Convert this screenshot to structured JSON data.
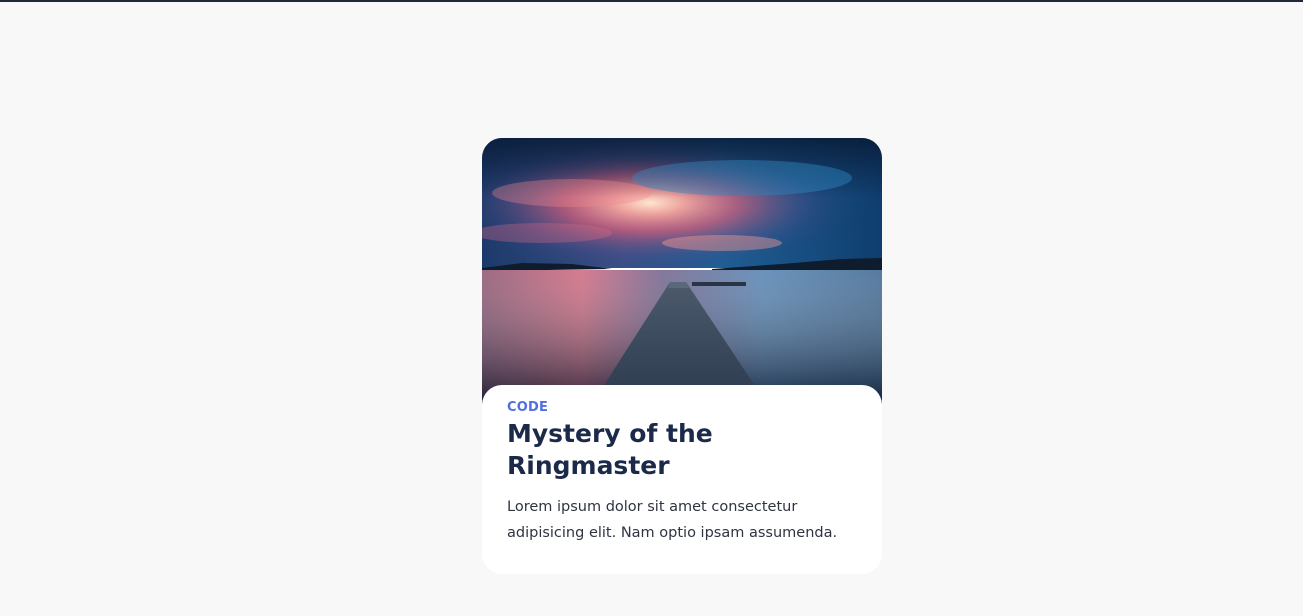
{
  "card": {
    "image": {
      "semantic": "sunset-lake-pier-photo"
    },
    "tag": "CODE",
    "title": "Mystery of the Ringmaster",
    "description": "Lorem ipsum dolor sit amet consectetur adipisicing elit. Nam optio ipsam assumenda."
  },
  "colors": {
    "page_background": "#f8f8f8",
    "tag": "#4f6fe3",
    "title": "#1c2a4a",
    "description": "#2e3440",
    "card_background": "#ffffff"
  }
}
